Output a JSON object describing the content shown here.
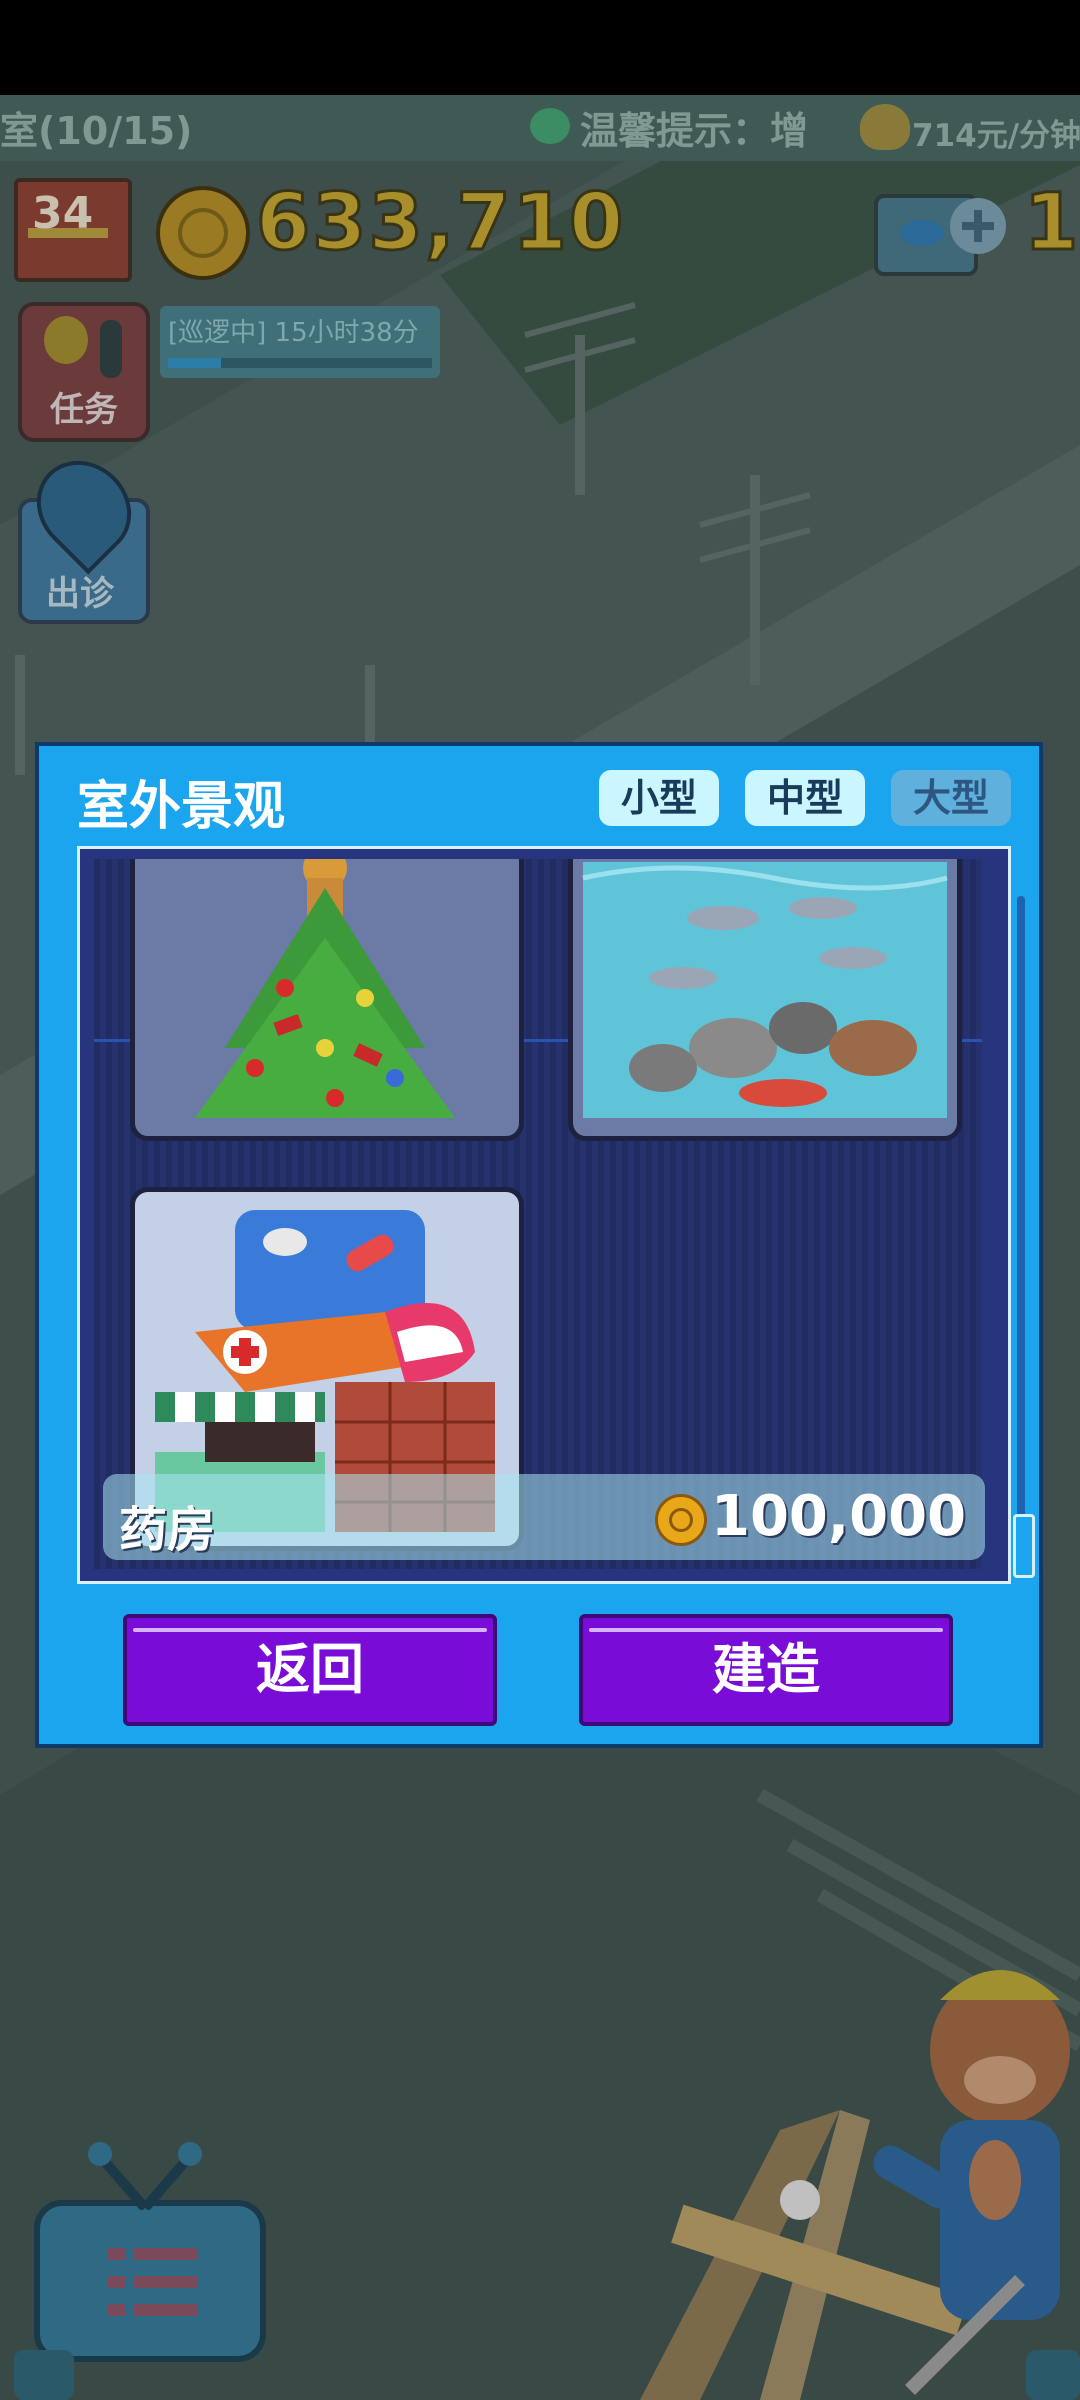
{
  "hud": {
    "room_count": "室(10/15)",
    "tip": "温馨提示：增",
    "income_rate": "714元/分钟",
    "level": "34",
    "coins": "633,710",
    "fish_count": "1",
    "patrol_status": "[巡逻中] 15小时38分",
    "patrol_progress": 0.2,
    "task_label": "任务",
    "clinic_label": "出诊"
  },
  "dialog": {
    "title": "室外景观",
    "tabs": [
      {
        "label": "小型",
        "active": true
      },
      {
        "label": "中型",
        "active": true
      },
      {
        "label": "大型",
        "active": false
      }
    ],
    "items": [
      {
        "icon": "christmas-tree"
      },
      {
        "icon": "fish-pond"
      },
      {
        "icon": "pharmacy"
      }
    ],
    "selected_item": {
      "name": "药房",
      "price": "100,000"
    },
    "back_label": "返回",
    "build_label": "建造"
  },
  "colors": {
    "dialog_bg": "#1aa5ee",
    "button": "#7a0cd8",
    "grid_bg": "#27347e"
  }
}
